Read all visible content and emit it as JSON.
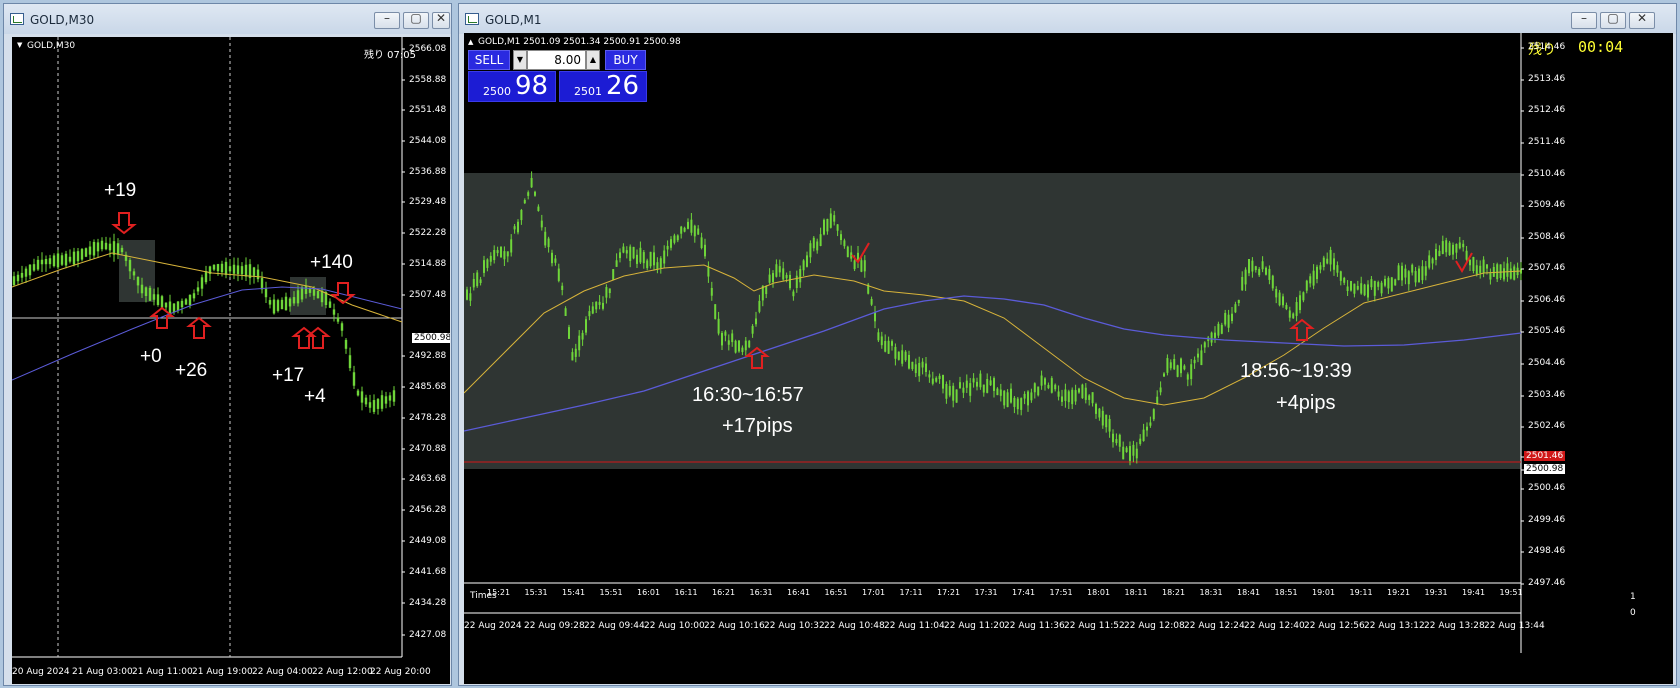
{
  "left_window": {
    "title": "GOLD,M30",
    "chart_header": "GOLD,M30",
    "remaining": "残り 07:05",
    "current_price": "2500.98",
    "price_axis": [
      "2566.08",
      "2558.88",
      "2551.48",
      "2544.08",
      "2536.88",
      "2529.48",
      "2522.28",
      "2514.88",
      "2507.48",
      "2500.98",
      "2492.88",
      "2485.68",
      "2478.28",
      "2470.88",
      "2463.68",
      "2456.28",
      "2449.08",
      "2441.68",
      "2434.28",
      "2427.08"
    ],
    "time_axis": [
      "20 Aug 2024",
      "21 Aug 03:00",
      "21 Aug 11:00",
      "21 Aug 19:00",
      "22 Aug 04:00",
      "22 Aug 12:00",
      "22 Aug 20:00"
    ],
    "annotations": [
      "+19",
      "+0",
      "+26",
      "+140",
      "+17",
      "+4"
    ]
  },
  "right_window": {
    "title": "GOLD,M1",
    "chart_header": "GOLD,M1  2501.09 2501.34 2500.91 2500.98",
    "remaining_label": "残り",
    "remaining_time": "00:04",
    "one_click": {
      "sell_label": "SELL",
      "buy_label": "BUY",
      "lot": "8.00",
      "sell_price_small": "2500",
      "sell_price_big": "98",
      "buy_price_small": "2501",
      "buy_price_big": "26"
    },
    "price_axis": [
      "2514.46",
      "2513.46",
      "2512.46",
      "2511.46",
      "2510.46",
      "2509.46",
      "2508.46",
      "2507.46",
      "2506.46",
      "2505.46",
      "2504.46",
      "2503.46",
      "2502.46",
      "2501.46",
      "2500.98",
      "2500.46",
      "2499.46",
      "2498.46",
      "2497.46"
    ],
    "time_axis_upper": [
      "15:21",
      "15:31",
      "15:41",
      "15:51",
      "16:01",
      "16:11",
      "16:21",
      "16:31",
      "16:41",
      "16:51",
      "17:01",
      "17:11",
      "17:21",
      "17:31",
      "17:41",
      "17:51",
      "18:01",
      "18:11",
      "18:21",
      "18:31",
      "18:41",
      "18:51",
      "19:01",
      "19:11",
      "19:21",
      "19:31",
      "19:41",
      "19:51"
    ],
    "time_axis_lower": [
      "22 Aug 2024",
      "22 Aug 09:28",
      "22 Aug 09:44",
      "22 Aug 10:00",
      "22 Aug 10:16",
      "22 Aug 10:32",
      "22 Aug 10:48",
      "22 Aug 11:04",
      "22 Aug 11:20",
      "22 Aug 11:36",
      "22 Aug 11:52",
      "22 Aug 12:08",
      "22 Aug 12:24",
      "22 Aug 12:40",
      "22 Aug 12:56",
      "22 Aug 13:12",
      "22 Aug 13:28",
      "22 Aug 13:44"
    ],
    "sub_window_label": "Times",
    "sub_axis": [
      "1",
      "0"
    ],
    "annotations": {
      "range1": "16:30~16:57",
      "pips1": "+17pips",
      "range2": "18:56~19:39",
      "pips2": "+4pips"
    }
  },
  "colors": {
    "candle": "#6fd63a",
    "ma_fast": "#d8b43a",
    "ma_slow": "#5b5bd8",
    "arrow": "#e02020",
    "bid_line": "#d01818",
    "zone": "#2f3533"
  }
}
